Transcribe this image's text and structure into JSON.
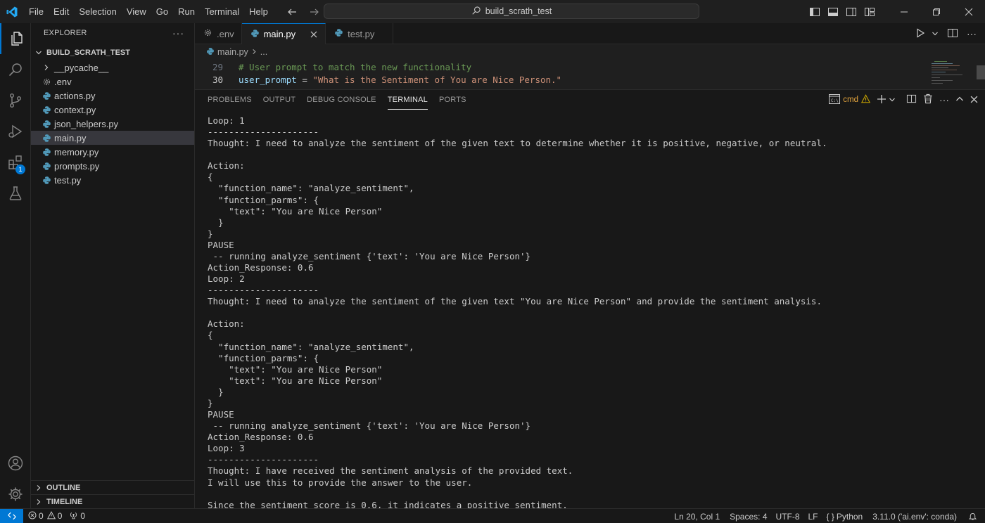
{
  "menu": [
    "File",
    "Edit",
    "Selection",
    "View",
    "Go",
    "Run",
    "Terminal",
    "Help"
  ],
  "command_center": {
    "label": "build_scrath_test"
  },
  "explorer": {
    "title": "EXPLORER",
    "more": "···",
    "folder": "BUILD_SCRATH_TEST",
    "items": [
      {
        "label": "__pycache__",
        "type": "folder"
      },
      {
        "label": ".env",
        "type": "gear"
      },
      {
        "label": "actions.py",
        "type": "python"
      },
      {
        "label": "context.py",
        "type": "python"
      },
      {
        "label": "json_helpers.py",
        "type": "python"
      },
      {
        "label": "main.py",
        "type": "python",
        "selected": true
      },
      {
        "label": "memory.py",
        "type": "python"
      },
      {
        "label": "prompts.py",
        "type": "python"
      },
      {
        "label": "test.py",
        "type": "python"
      }
    ],
    "outline": "OUTLINE",
    "timeline": "TIMELINE"
  },
  "activity": {
    "extensions_badge": "1"
  },
  "tabs": [
    {
      "label": ".env",
      "icon": "gear-icon"
    },
    {
      "label": "main.py",
      "icon": "python-icon",
      "active": true
    },
    {
      "label": "test.py",
      "icon": "python-icon"
    }
  ],
  "breadcrumb": {
    "file": "main.py",
    "rest": "..."
  },
  "code": [
    {
      "ln": "29",
      "comment": "# User prompt to match the new functionality"
    },
    {
      "ln": "30",
      "var": "user_prompt",
      "op": " = ",
      "str": "\"What is the Sentiment of You are Nice Person.\""
    }
  ],
  "panel": {
    "tabs": [
      "PROBLEMS",
      "OUTPUT",
      "DEBUG CONSOLE",
      "TERMINAL",
      "PORTS"
    ],
    "active_tab": "TERMINAL",
    "terminal_name": "cmd"
  },
  "terminal_lines": [
    "Loop: 1",
    "---------------------",
    "Thought: I need to analyze the sentiment of the given text to determine whether it is positive, negative, or neutral.",
    "",
    "Action:",
    "{",
    "  \"function_name\": \"analyze_sentiment\",",
    "  \"function_parms\": {",
    "    \"text\": \"You are Nice Person\"",
    "  }",
    "}",
    "PAUSE",
    " -- running analyze_sentiment {'text': 'You are Nice Person'}",
    "Action_Response: 0.6",
    "Loop: 2",
    "---------------------",
    "Thought: I need to analyze the sentiment of the given text \"You are Nice Person\" and provide the sentiment analysis.",
    "",
    "Action:",
    "{",
    "  \"function_name\": \"analyze_sentiment\",",
    "  \"function_parms\": {",
    "    \"text\": \"You are Nice Person\"",
    "    \"text\": \"You are Nice Person\"",
    "  }",
    "}",
    "PAUSE",
    " -- running analyze_sentiment {'text': 'You are Nice Person'}",
    "Action_Response: 0.6",
    "Loop: 3",
    "---------------------",
    "Thought: I have received the sentiment analysis of the provided text.",
    "I will use this to provide the answer to the user.",
    "",
    "Since the sentiment score is 0.6, it indicates a positive sentiment."
  ],
  "status": {
    "errors": "0",
    "warnings": "0",
    "ports": "0",
    "position": "Ln 20, Col 1",
    "spaces": "Spaces: 4",
    "encoding": "UTF-8",
    "eol": "LF",
    "language": "Python",
    "interpreter": "3.11.0 ('ai.env': conda)"
  },
  "colors": {
    "accent": "#0078d4",
    "python_icon": "#519aba",
    "warning": "#cca700"
  }
}
